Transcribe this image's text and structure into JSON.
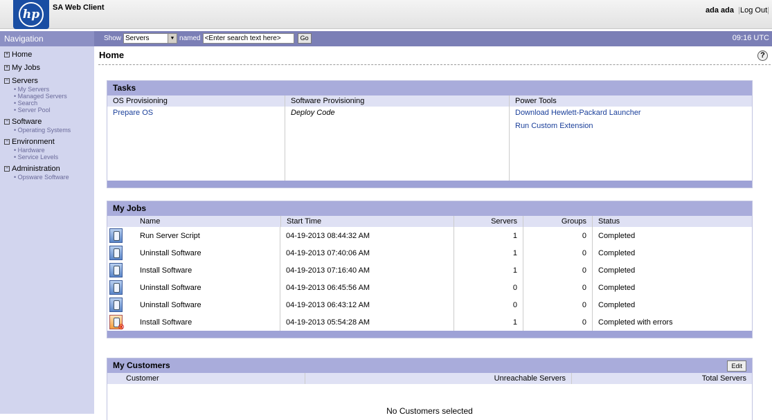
{
  "header": {
    "logo_text": "hp",
    "app_title": "SA Web Client",
    "user": "ada ada",
    "logout": "Log Out"
  },
  "navbar": {
    "nav_title": "Navigation",
    "show_label": "Show",
    "show_value": "Servers",
    "named_label": "named",
    "search_placeholder": "<Enter search text here>",
    "go_label": "Go",
    "time": "09:16 UTC"
  },
  "sidebar": {
    "groups": [
      {
        "label": "Home",
        "toggle": "+",
        "items": []
      },
      {
        "label": "My Jobs",
        "toggle": "+",
        "items": []
      },
      {
        "label": "Servers",
        "toggle": "−",
        "items": [
          "My Servers",
          "Managed Servers",
          "Search",
          "Server Pool"
        ]
      },
      {
        "label": "Software",
        "toggle": "−",
        "items": [
          "Operating Systems"
        ]
      },
      {
        "label": "Environment",
        "toggle": "−",
        "items": [
          "Hardware",
          "Service Levels"
        ]
      },
      {
        "label": "Administration",
        "toggle": "−",
        "items": [
          "Opsware Software"
        ]
      }
    ]
  },
  "page": {
    "title": "Home",
    "help_label": "?"
  },
  "tasks": {
    "title": "Tasks",
    "columns": [
      {
        "header": "OS Provisioning",
        "items": [
          {
            "label": "Prepare OS",
            "style": "link"
          }
        ]
      },
      {
        "header": "Software Provisioning",
        "items": [
          {
            "label": "Deploy Code",
            "style": "italic"
          }
        ]
      },
      {
        "header": "Power Tools",
        "items": [
          {
            "label": "Download Hewlett-Packard Launcher",
            "style": "link"
          },
          {
            "label": "Run Custom Extension",
            "style": "link"
          }
        ]
      }
    ]
  },
  "jobs": {
    "title": "My Jobs",
    "columns": {
      "name": "Name",
      "start": "Start Time",
      "servers": "Servers",
      "groups": "Groups",
      "status": "Status"
    },
    "rows": [
      {
        "icon": "job-script-icon",
        "name": "Run Server Script",
        "start": "04-19-2013 08:44:32 AM",
        "servers": "1",
        "groups": "0",
        "status": "Completed"
      },
      {
        "icon": "job-uninstall-icon",
        "name": "Uninstall Software",
        "start": "04-19-2013 07:40:06 AM",
        "servers": "1",
        "groups": "0",
        "status": "Completed"
      },
      {
        "icon": "job-install-icon",
        "name": "Install Software",
        "start": "04-19-2013 07:16:40 AM",
        "servers": "1",
        "groups": "0",
        "status": "Completed"
      },
      {
        "icon": "job-uninstall-icon",
        "name": "Uninstall Software",
        "start": "04-19-2013 06:45:56 AM",
        "servers": "0",
        "groups": "0",
        "status": "Completed"
      },
      {
        "icon": "job-uninstall-icon",
        "name": "Uninstall Software",
        "start": "04-19-2013 06:43:12 AM",
        "servers": "0",
        "groups": "0",
        "status": "Completed"
      },
      {
        "icon": "job-error-icon",
        "name": "Install Software",
        "start": "04-19-2013 05:54:28 AM",
        "servers": "1",
        "groups": "0",
        "status": "Completed with errors"
      }
    ]
  },
  "customers": {
    "title": "My Customers",
    "edit_label": "Edit",
    "columns": {
      "customer": "Customer",
      "unreachable": "Unreachable Servers",
      "total": "Total Servers"
    },
    "empty_text": "No Customers selected"
  }
}
